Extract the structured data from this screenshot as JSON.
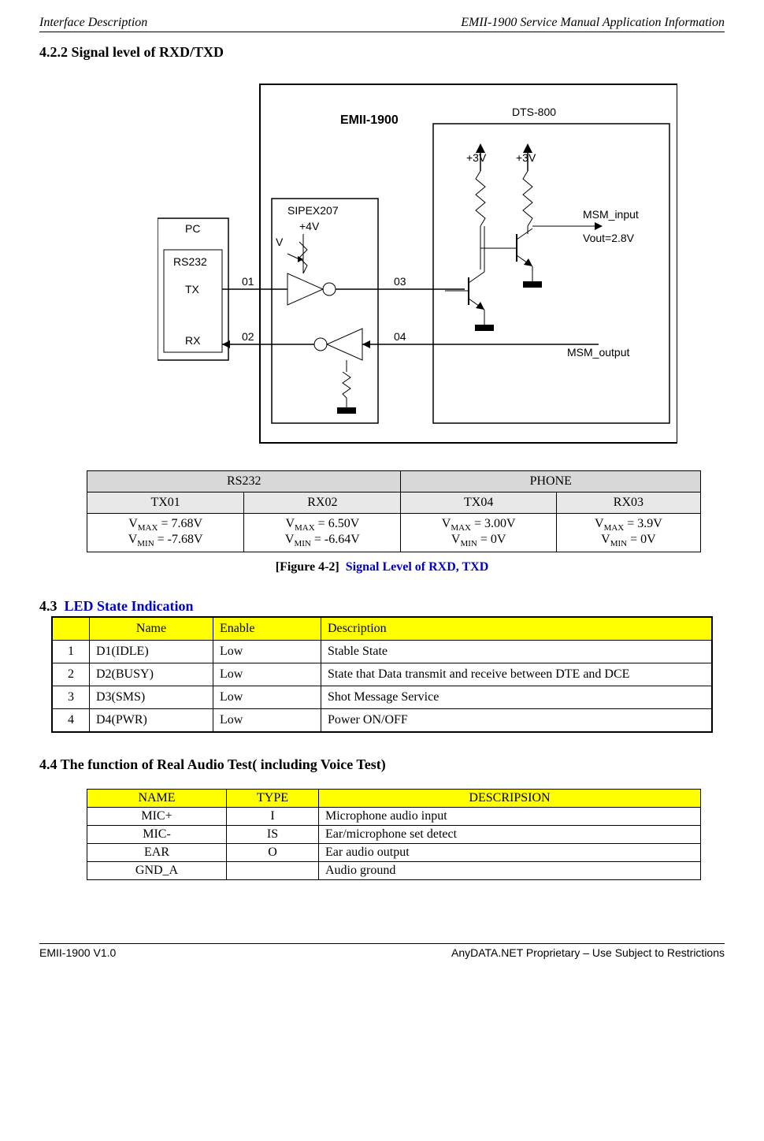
{
  "header": {
    "left": "Interface Description",
    "right": "EMII-1900 Service Manual Application Information"
  },
  "section_422": {
    "heading": "4.2.2 Signal level of RXD/TXD"
  },
  "diagram": {
    "emii_label": "EMII-1900",
    "pc_label": "PC",
    "rs232_label": "RS232",
    "tx_label": "TX",
    "rx_label": "RX",
    "sipex_label": "SIPEX207",
    "sipex_voltage": "+4V",
    "v_label": "V",
    "wire01": "01",
    "wire02": "02",
    "wire03": "03",
    "wire04": "04",
    "dts_label": "DTS-800",
    "v3_left": "+3V",
    "v3_right": "+3V",
    "msm_input": "MSM_input",
    "vout": "Vout=2.8V",
    "msm_output": "MSM_output"
  },
  "signal_table": {
    "hdr_rs232": "RS232",
    "hdr_phone": "PHONE",
    "tx01": "TX01",
    "rx02": "RX02",
    "tx04": "TX04",
    "rx03": "RX03",
    "tx01_vmax_label": "V",
    "tx01_vmax_sub": "MAX",
    "tx01_vmax_val": " = 7.68V",
    "tx01_vmin_label": "V",
    "tx01_vmin_sub": "MIN",
    "tx01_vmin_val": " = -7.68V",
    "rx02_vmax_label": "V",
    "rx02_vmax_sub": "MAX",
    "rx02_vmax_val": " = 6.50V",
    "rx02_vmin_label": "V",
    "rx02_vmin_sub": "MIN",
    "rx02_vmin_val": " = -6.64V",
    "tx04_vmax_label": "V",
    "tx04_vmax_sub": "MAX",
    "tx04_vmax_val": " = 3.00V",
    "tx04_vmin_label": "V",
    "tx04_vmin_sub": "MIN",
    "tx04_vmin_val": " = 0V",
    "rx03_vmax_label": "V",
    "rx03_vmax_sub": "MAX",
    "rx03_vmax_val": " = 3.9V",
    "rx03_vmin_label": "V",
    "rx03_vmin_sub": "MIN",
    "rx03_vmin_val": " = 0V"
  },
  "figure_caption": {
    "bracket": "[Figure 4-2]",
    "title": "Signal Level of RXD, TXD"
  },
  "section_43": {
    "num": "4.3",
    "title": "LED State Indication",
    "hdr_name": "Name",
    "hdr_enable": "Enable",
    "hdr_desc": "Description",
    "rows": [
      {
        "num": "1",
        "name": "D1(IDLE)",
        "enable": "Low",
        "desc": "Stable State"
      },
      {
        "num": "2",
        "name": "D2(BUSY)",
        "enable": "Low",
        "desc": "State that Data transmit and receive between DTE and DCE"
      },
      {
        "num": "3",
        "name": "D3(SMS)",
        "enable": "Low",
        "desc": "Shot Message Service"
      },
      {
        "num": "4",
        "name": "D4(PWR)",
        "enable": "Low",
        "desc": "Power ON/OFF"
      }
    ]
  },
  "section_44": {
    "heading": "4.4   The function of Real Audio Test( including Voice Test)",
    "hdr_name": "NAME",
    "hdr_type": "TYPE",
    "hdr_desc": "DESCRIPSION",
    "rows": [
      {
        "name": "MIC+",
        "type": "I",
        "desc": "Microphone audio input"
      },
      {
        "name": "MIC-",
        "type": "IS",
        "desc": "Ear/microphone set detect"
      },
      {
        "name": "EAR",
        "type": "O",
        "desc": "Ear audio output"
      },
      {
        "name": "GND_A",
        "type": "",
        "desc": "Audio ground"
      }
    ]
  },
  "footer": {
    "left": "EMII-1900 V1.0",
    "right": "AnyDATA.NET Proprietary – Use Subject to Restrictions"
  }
}
